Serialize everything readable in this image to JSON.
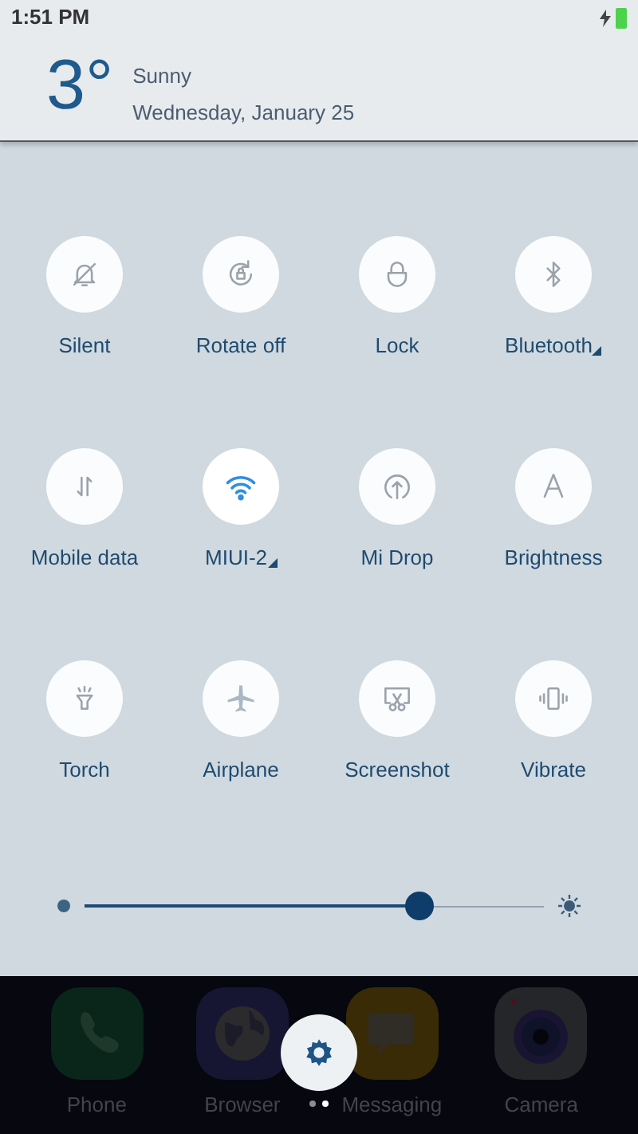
{
  "status_bar": {
    "time": "1:51 PM",
    "charging": true
  },
  "weather": {
    "temperature": "3°",
    "condition": "Sunny",
    "date": "Wednesday, January 25"
  },
  "toggles": [
    {
      "kind": "silent",
      "label": "Silent",
      "on": false,
      "expandable": false
    },
    {
      "kind": "rotate",
      "label": "Rotate off",
      "on": false,
      "expandable": false
    },
    {
      "kind": "lock",
      "label": "Lock",
      "on": false,
      "expandable": false
    },
    {
      "kind": "bluetooth",
      "label": "Bluetooth",
      "on": false,
      "expandable": true
    },
    {
      "kind": "data",
      "label": "Mobile data",
      "on": false,
      "expandable": false
    },
    {
      "kind": "wifi",
      "label": "MIUI-2",
      "on": true,
      "expandable": true
    },
    {
      "kind": "midrop",
      "label": "Mi Drop",
      "on": false,
      "expandable": false
    },
    {
      "kind": "brightness",
      "label": "Brightness",
      "on": false,
      "expandable": false
    },
    {
      "kind": "torch",
      "label": "Torch",
      "on": false,
      "expandable": false
    },
    {
      "kind": "airplane",
      "label": "Airplane",
      "on": false,
      "expandable": false
    },
    {
      "kind": "screenshot",
      "label": "Screenshot",
      "on": false,
      "expandable": false
    },
    {
      "kind": "vibrate",
      "label": "Vibrate",
      "on": false,
      "expandable": false
    }
  ],
  "brightness_slider": {
    "level": 0.73
  },
  "dock": {
    "apps": [
      {
        "kind": "phone",
        "label": "Phone"
      },
      {
        "kind": "browser",
        "label": "Browser"
      },
      {
        "kind": "messaging",
        "label": "Messaging"
      },
      {
        "kind": "camera",
        "label": "Camera"
      }
    ],
    "pages": [
      {
        "selected": false
      },
      {
        "selected": true
      }
    ]
  }
}
